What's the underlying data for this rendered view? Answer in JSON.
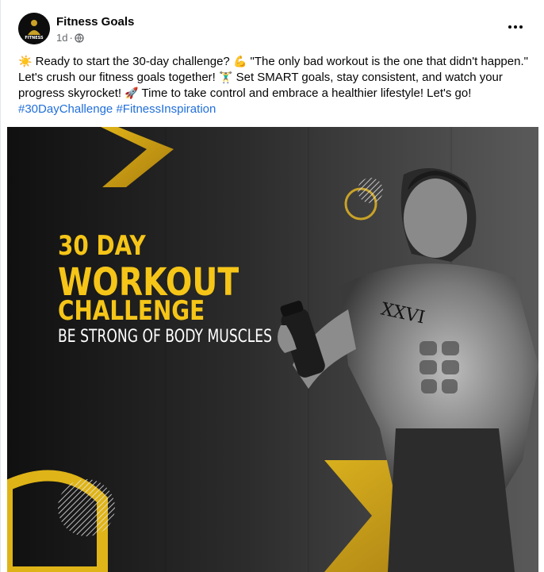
{
  "post": {
    "page_name": "Fitness Goals",
    "time": "1d",
    "visibility_icon": "globe-icon",
    "avatar_text": "FITNESS",
    "lines": [
      {
        "emoji_start": "☀️",
        "text": " Ready to start the 30-day challenge? ",
        "emoji_mid": "💪",
        "text2": " \"The only bad workout is the one that didn't happen.\""
      },
      {
        "text": "Let's crush our fitness goals together! ",
        "emoji": "🏋️‍♂️",
        "text2": " Set SMART goals, stay consistent, and watch your"
      },
      {
        "text": "progress skyrocket! ",
        "emoji": "🚀",
        "text2": " Time to take control and embrace a healthier lifestyle! Let's go!"
      }
    ],
    "hashtags": [
      "#30DayChallenge",
      "#FitnessInspiration"
    ]
  },
  "image": {
    "line1": "30 DAY",
    "line2": "WORKOUT",
    "line3": "CHALLENGE",
    "subtitle": "BE STRONG OF BODY MUSCLES",
    "tattoo": "XXVI",
    "accent_color": "#f5c518"
  }
}
